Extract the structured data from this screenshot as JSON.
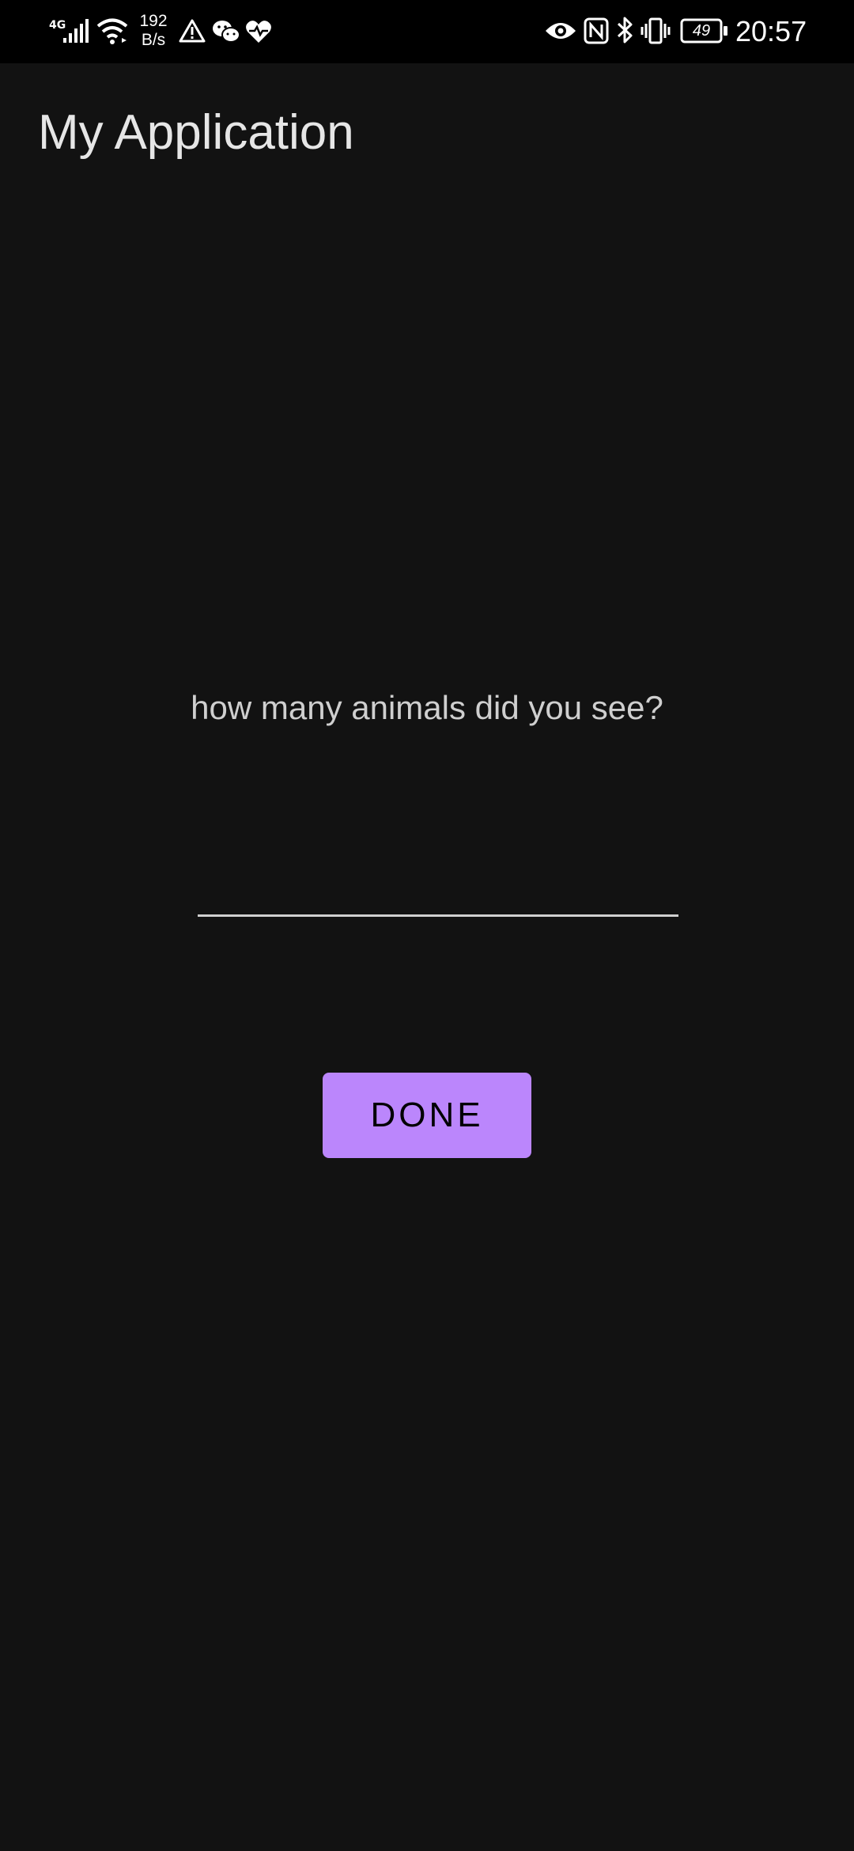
{
  "status_bar": {
    "network_type": "4G",
    "speed_value": "192",
    "speed_unit": "B/s",
    "battery_level": "49",
    "time": "20:57",
    "icons": [
      "signal-icon",
      "wifi-icon",
      "warning-icon",
      "wechat-icon",
      "health-icon",
      "eye-icon",
      "nfc-icon",
      "bluetooth-icon",
      "vibrate-icon",
      "battery-icon"
    ]
  },
  "app_bar": {
    "title": "My Application"
  },
  "main": {
    "question": "how many animals did you see?",
    "answer_value": "",
    "done_label": "DONE"
  },
  "colors": {
    "background": "#121212",
    "status_bar": "#000000",
    "accent": "#bb86fc",
    "text_primary": "#e6e6e6",
    "text_secondary": "#cfcfcf"
  }
}
